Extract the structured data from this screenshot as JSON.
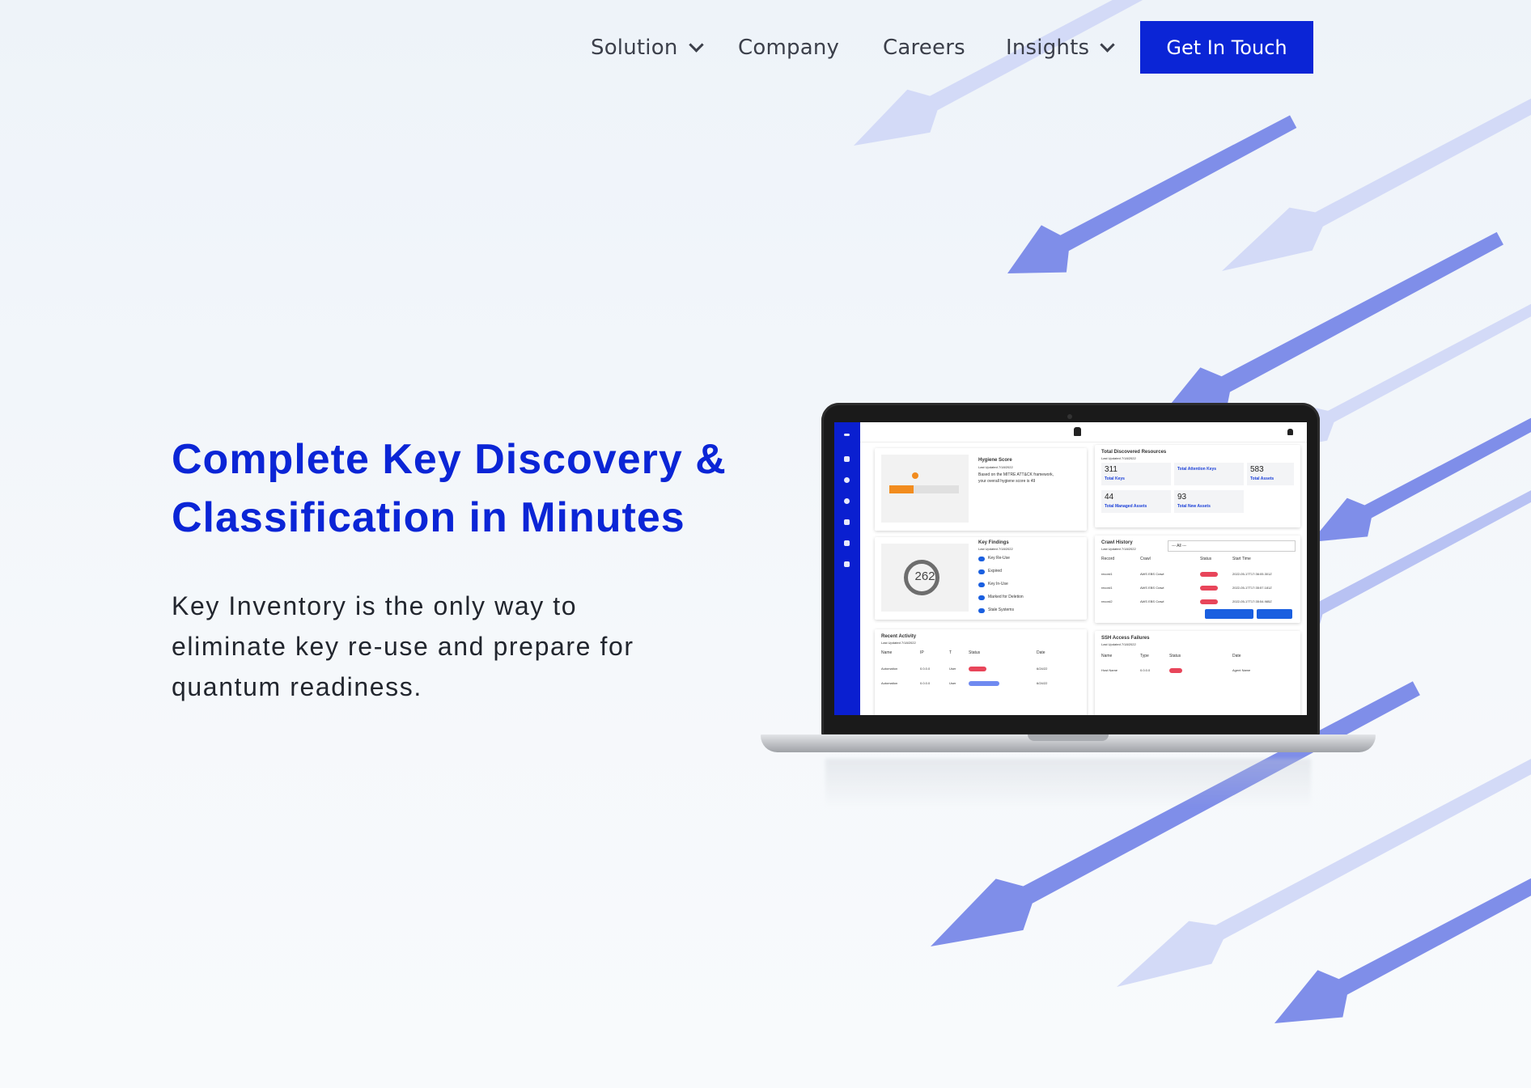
{
  "nav": {
    "items": [
      {
        "label": "Solution",
        "has_dropdown": true
      },
      {
        "label": "Company",
        "has_dropdown": false
      },
      {
        "label": "Careers",
        "has_dropdown": false
      },
      {
        "label": "Insights",
        "has_dropdown": true
      }
    ],
    "cta_label": "Get In Touch"
  },
  "hero": {
    "title_line1": "Complete Key Discovery &",
    "title_line2": "Classification in Minutes",
    "subtitle_line1": "Key Inventory is the only way to",
    "subtitle_line2": "eliminate key re-use and prepare for",
    "subtitle_line3": "quantum readiness."
  },
  "dashboard": {
    "hygiene": {
      "title": "Hygiene Score",
      "updated": "Last Updated 7/18/2022",
      "note1": "Based on the MITRE ATT&CK framework,",
      "note2": "your overall hygiene score is 49"
    },
    "resources": {
      "title": "Total Discovered Resources",
      "updated": "Last Updated 7/18/2022",
      "stats": [
        {
          "value": "311",
          "label": "Total Keys"
        },
        {
          "value": "",
          "label": "Total Attention Keys"
        },
        {
          "value": "583",
          "label": "Total Assets"
        },
        {
          "value": "44",
          "label": "Total Managed Assets"
        },
        {
          "value": "93",
          "label": "Total New Assets"
        }
      ]
    },
    "findings": {
      "title": "Key Findings",
      "updated": "Last Updated 7/18/2022",
      "total": "262",
      "items": [
        "Key Re-Use",
        "Expired",
        "Key In-Use",
        "Marked for Deletion",
        "Stale Systems"
      ]
    },
    "crawl": {
      "title": "Crawl History",
      "updated": "Last Updated 7/18/2022",
      "filter": "--- All ---",
      "columns": [
        "Record",
        "Crawl",
        "Status",
        "Start Time"
      ],
      "rows": [
        {
          "record": "record1",
          "crawl": "AWS EBS Crawl",
          "start": "2022-05-17T17:36:05.301Z"
        },
        {
          "record": "record1",
          "crawl": "AWS EBS Crawl",
          "start": "2022-05-17T17:35:57.181Z"
        },
        {
          "record": "record2",
          "crawl": "AWS EBS Crawl",
          "start": "2022-05-17T17:35:54.985Z"
        }
      ]
    },
    "activity": {
      "title": "Recent Activity",
      "updated": "Last Updated 7/18/2022",
      "columns": [
        "Name",
        "IP",
        "T",
        "Status",
        "Date"
      ],
      "rows": [
        {
          "name": "Automation",
          "ip": "0.0.0.0",
          "type": "User",
          "date": "6/24/22"
        },
        {
          "name": "Automation",
          "ip": "0.0.0.0",
          "type": "User",
          "date": "6/24/22"
        }
      ]
    },
    "ssh": {
      "title": "SSH Access Failures",
      "updated": "Last Updated 7/18/2022",
      "columns": [
        "Name",
        "Type",
        "Status",
        "Date"
      ],
      "rows": [
        {
          "name": "Host Name",
          "type": "0.0.0.0",
          "date": "Agent Name"
        }
      ]
    }
  },
  "colors": {
    "brand_blue": "#0b25d6",
    "arrow_dark": "#7b8ae8",
    "arrow_light": "#cdd4f5",
    "status_red": "#e8455a"
  }
}
